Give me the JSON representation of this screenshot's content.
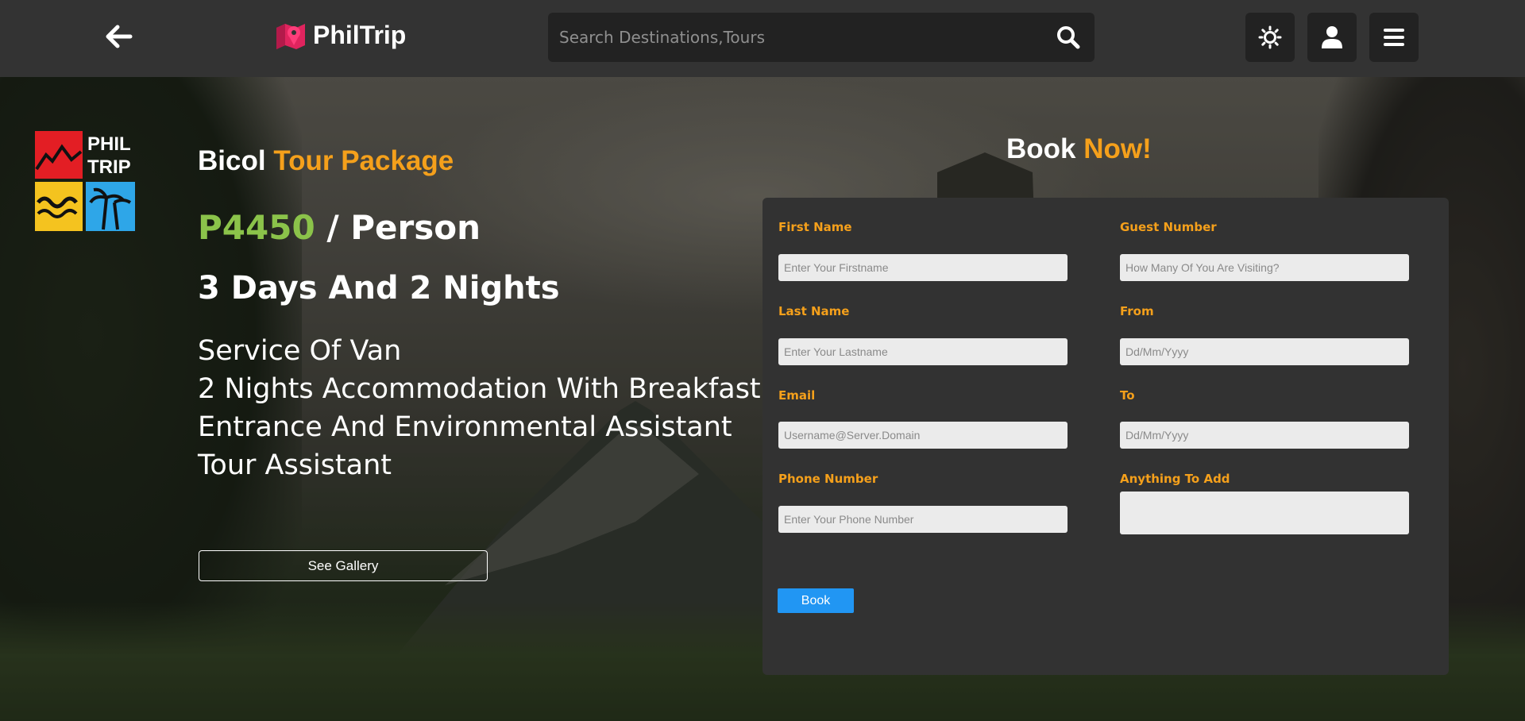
{
  "header": {
    "brand_name": "PhilTrip",
    "search_placeholder": "Search Destinations,Tours"
  },
  "logo_badge": {
    "line1": "PHIL",
    "line2": "TRIP"
  },
  "tour": {
    "title_white": "Bicol",
    "title_orange": "Tour Package",
    "price_amount": "P4450",
    "price_unit": "/ Person",
    "duration": "3 Days And 2 Nights",
    "inclusions": [
      "Service Of Van",
      "2 Nights Accommodation With Breakfast",
      "Entrance And Environmental Assistant",
      "Tour Assistant"
    ],
    "gallery_button": "See Gallery"
  },
  "booking": {
    "heading_white": "Book",
    "heading_orange": "Now!",
    "fields": {
      "first_name": {
        "label": "First Name",
        "placeholder": "Enter Your Firstname"
      },
      "last_name": {
        "label": "Last Name",
        "placeholder": "Enter Your Lastname"
      },
      "email": {
        "label": "Email",
        "placeholder": "Username@Server.Domain"
      },
      "phone": {
        "label": "Phone Number",
        "placeholder": "Enter Your Phone Number"
      },
      "guest_number": {
        "label": "Guest Number",
        "placeholder": "How Many Of You Are Visiting?"
      },
      "from": {
        "label": "From",
        "placeholder": "Dd/Mm/Yyyy"
      },
      "to": {
        "label": "To",
        "placeholder": "Dd/Mm/Yyyy"
      },
      "anything": {
        "label": "Anything To Add",
        "placeholder": ""
      }
    },
    "submit_label": "Book"
  },
  "icons": {
    "back": "arrow-left-icon",
    "brand": "map-pin-icon",
    "search": "search-icon",
    "theme": "sun-icon",
    "account": "user-icon",
    "menu": "hamburger-menu-icon"
  },
  "colors": {
    "accent_orange": "#f5a01b",
    "price_green": "#8bc34a",
    "button_blue": "#2196f3",
    "header_bg": "#333333",
    "brand_pink": "#e0245e"
  }
}
